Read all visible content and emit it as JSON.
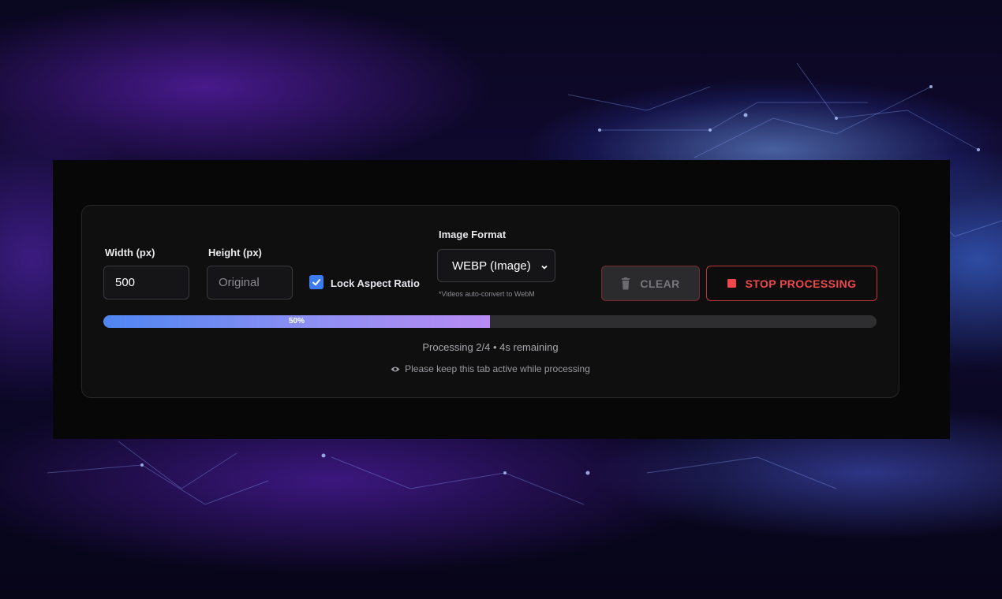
{
  "width_field": {
    "label": "Width (px)",
    "value": "500"
  },
  "height_field": {
    "label": "Height (px)",
    "placeholder": "Original"
  },
  "lock_aspect": {
    "label": "Lock Aspect Ratio",
    "checked": true
  },
  "format": {
    "label": "Image Format",
    "selected": "WEBP (Image)",
    "hint": "*Videos auto-convert to WebM"
  },
  "buttons": {
    "clear_label": "CLEAR",
    "clear_icon": "trash-icon",
    "stop_label": "STOP PROCESSING",
    "stop_icon": "stop-square-icon"
  },
  "progress": {
    "percent": 50,
    "label": "50%"
  },
  "status_text": "Processing 2/4 • 4s remaining",
  "note": {
    "icon": "eye-icon",
    "text": "Please keep this tab active while processing"
  },
  "colors": {
    "accent_blue": "#4f86f2",
    "accent_purple": "#b78bf3",
    "stop_red": "#f0474c",
    "checkbox_blue": "#3d7bf0"
  }
}
